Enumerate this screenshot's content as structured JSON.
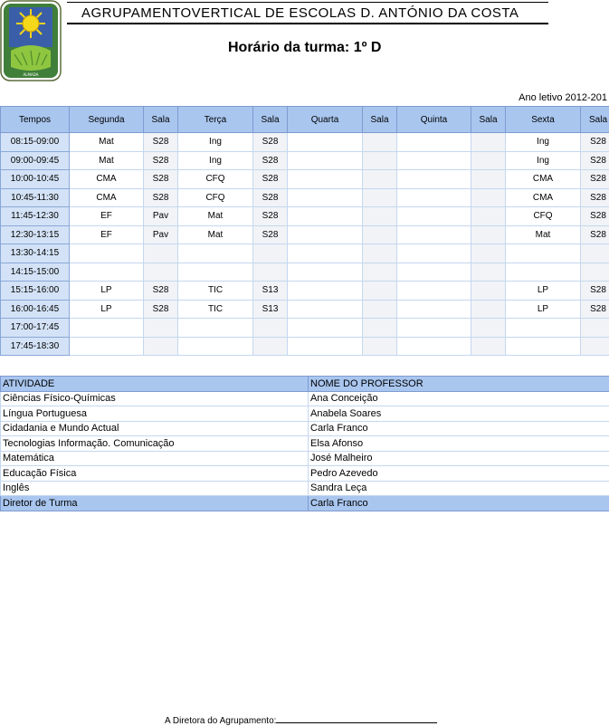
{
  "header": {
    "school_name": "AGRUPAMENTOVERTICAL  DE ESCOLAS  D.  ANTÓNIO  DA COSTA",
    "class_title": "Horário da turma:   1º D",
    "school_year": "Ano letivo 2012-201",
    "logo_text": "ESCOLA BÁSICA 2,3 D. ANTÓNIO DA COSTA – ALMADA"
  },
  "timetable": {
    "headers": [
      "Tempos",
      "Segunda",
      "Sala",
      "Terça",
      "Sala",
      "Quarta",
      "Sala",
      "Quinta",
      "Sala",
      "Sexta",
      "Sala"
    ],
    "rows": [
      [
        "08:15-09:00",
        "Mat",
        "S28",
        "Ing",
        "S28",
        "",
        "",
        "",
        "",
        "Ing",
        "S28"
      ],
      [
        "09:00-09:45",
        "Mat",
        "S28",
        "Ing",
        "S28",
        "",
        "",
        "",
        "",
        "Ing",
        "S28"
      ],
      [
        "10:00-10:45",
        "CMA",
        "S28",
        "CFQ",
        "S28",
        "",
        "",
        "",
        "",
        "CMA",
        "S28"
      ],
      [
        "10:45-11:30",
        "CMA",
        "S28",
        "CFQ",
        "S28",
        "",
        "",
        "",
        "",
        "CMA",
        "S28"
      ],
      [
        "11:45-12:30",
        "EF",
        "Pav",
        "Mat",
        "S28",
        "",
        "",
        "",
        "",
        "CFQ",
        "S28"
      ],
      [
        "12:30-13:15",
        "EF",
        "Pav",
        "Mat",
        "S28",
        "",
        "",
        "",
        "",
        "Mat",
        "S28"
      ],
      [
        "13:30-14:15",
        "",
        "",
        "",
        "",
        "",
        "",
        "",
        "",
        "",
        ""
      ],
      [
        "14:15-15:00",
        "",
        "",
        "",
        "",
        "",
        "",
        "",
        "",
        "",
        ""
      ],
      [
        "15:15-16:00",
        "LP",
        "S28",
        "TIC",
        "S13",
        "",
        "",
        "",
        "",
        "LP",
        "S28"
      ],
      [
        "16:00-16:45",
        "LP",
        "S28",
        "TIC",
        "S13",
        "",
        "",
        "",
        "",
        "LP",
        "S28"
      ],
      [
        "17:00-17:45",
        "",
        "",
        "",
        "",
        "",
        "",
        "",
        "",
        "",
        ""
      ],
      [
        "17:45-18:30",
        "",
        "",
        "",
        "",
        "",
        "",
        "",
        "",
        "",
        ""
      ]
    ]
  },
  "staff": {
    "header": [
      "ATIVIDADE",
      "NOME  DO  PROFESSOR"
    ],
    "rows": [
      [
        "Ciências  Físico-Químicas",
        "Ana Conceição"
      ],
      [
        "Língua Portuguesa",
        "Anabela Soares"
      ],
      [
        "Cidadania e Mundo  Actual",
        "Carla Franco"
      ],
      [
        "Tecnologias Informação. Comunicação",
        "Elsa Afonso"
      ],
      [
        "Matemática",
        "José Malheiro"
      ],
      [
        "Educação Física",
        "Pedro Azevedo"
      ],
      [
        "Inglês",
        "Sandra Leça"
      ]
    ],
    "director": [
      "Diretor de Turma",
      "Carla Franco"
    ]
  },
  "footer": {
    "signature_label": "A Diretora do Agrupamento:"
  }
}
